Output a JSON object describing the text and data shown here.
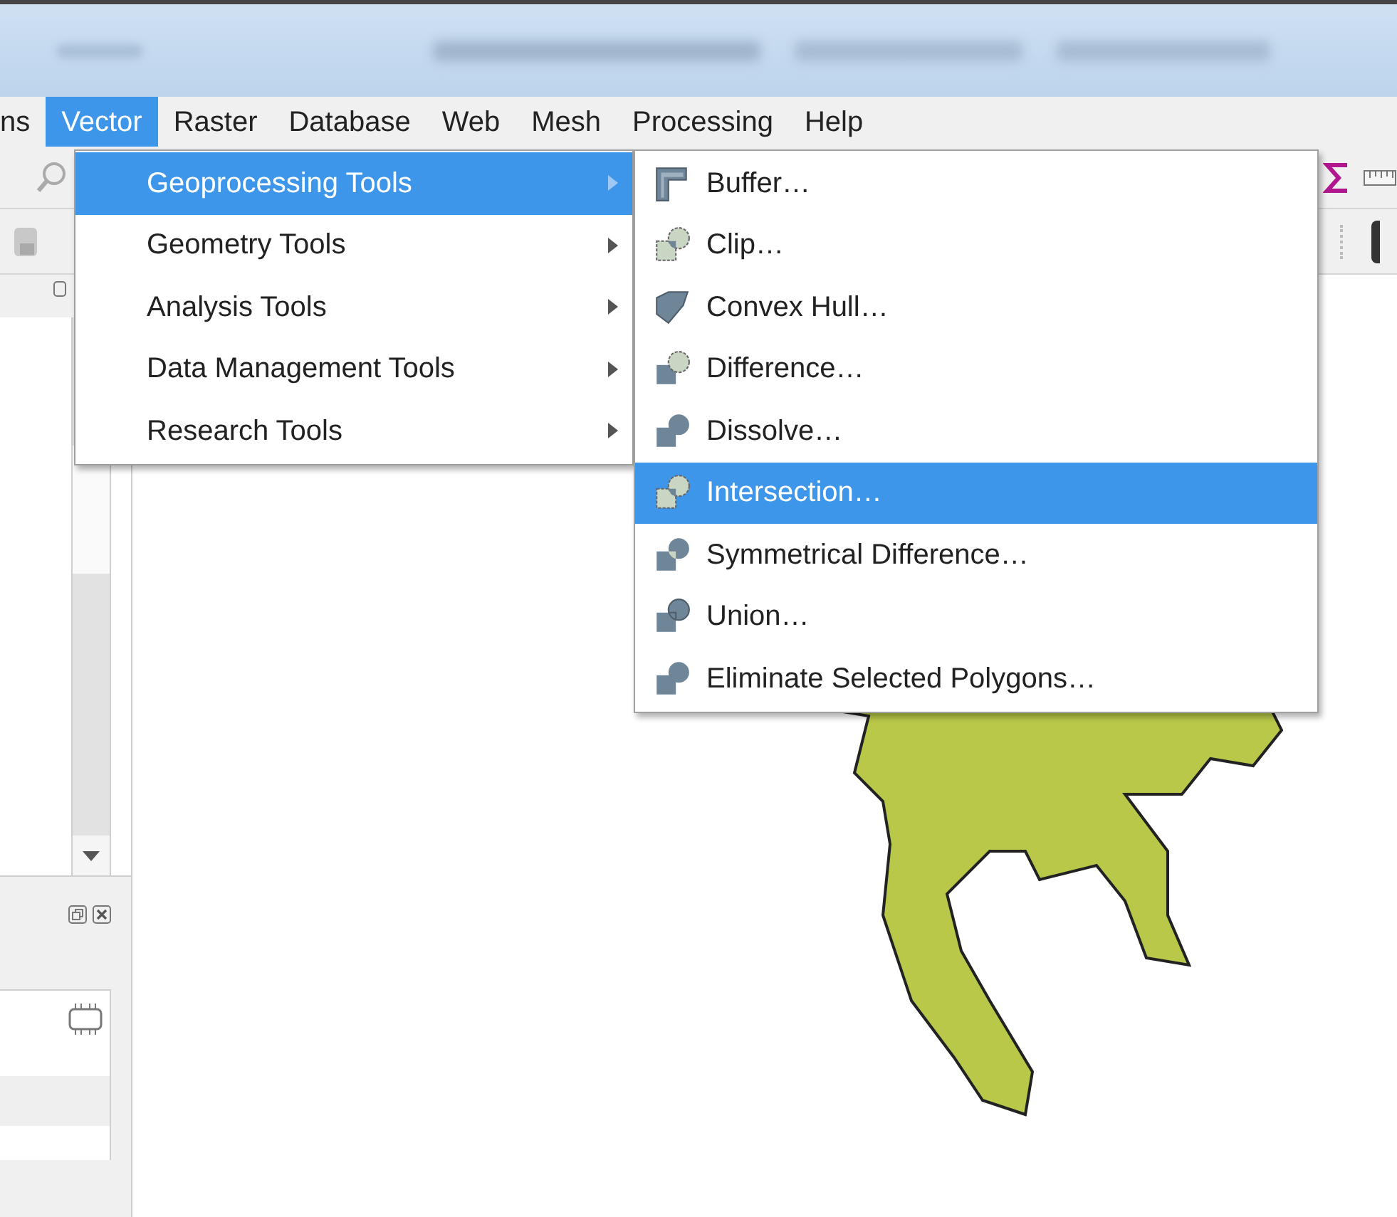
{
  "menubar": [
    {
      "label": "ns",
      "selected": false
    },
    {
      "label": "Vector",
      "selected": true
    },
    {
      "label": "Raster",
      "selected": false
    },
    {
      "label": "Database",
      "selected": false
    },
    {
      "label": "Web",
      "selected": false
    },
    {
      "label": "Mesh",
      "selected": false
    },
    {
      "label": "Processing",
      "selected": false
    },
    {
      "label": "Help",
      "selected": false
    }
  ],
  "vector_menu": [
    {
      "label": "Geoprocessing Tools",
      "selected": true
    },
    {
      "label": "Geometry Tools",
      "selected": false
    },
    {
      "label": "Analysis Tools",
      "selected": false
    },
    {
      "label": "Data Management Tools",
      "selected": false
    },
    {
      "label": "Research Tools",
      "selected": false
    }
  ],
  "geoprocessing_submenu": [
    {
      "label": "Buffer…",
      "kind": "buffer",
      "selected": false
    },
    {
      "label": "Clip…",
      "kind": "clip",
      "selected": false
    },
    {
      "label": "Convex Hull…",
      "kind": "hull",
      "selected": false
    },
    {
      "label": "Difference…",
      "kind": "difference",
      "selected": false
    },
    {
      "label": "Dissolve…",
      "kind": "dissolve",
      "selected": false
    },
    {
      "label": "Intersection…",
      "kind": "clip",
      "selected": true
    },
    {
      "label": "Symmetrical Difference…",
      "kind": "symdiff",
      "selected": false
    },
    {
      "label": "Union…",
      "kind": "union",
      "selected": false
    },
    {
      "label": "Eliminate Selected Polygons…",
      "kind": "dissolve",
      "selected": false
    }
  ]
}
